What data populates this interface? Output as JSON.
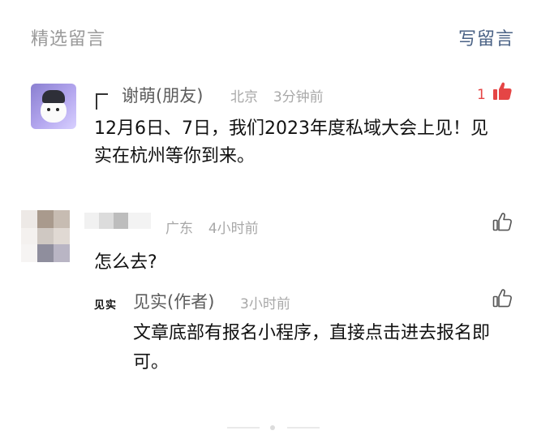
{
  "header": {
    "left_title": "精选留言",
    "right_action": "写留言"
  },
  "comments": [
    {
      "author": "谢萌(朋友)",
      "location": "北京",
      "time": "3分钟前",
      "likes": "1",
      "liked": true,
      "text": "12月6日、7日，我们2023年度私域大会上见！见实在杭州等你到来。",
      "icons": {
        "avatar": "avatar-bear-icon",
        "like": "thumbs-up-icon"
      },
      "colors": {
        "like_active": "#e54545"
      }
    },
    {
      "author": "",
      "location": "广东",
      "time": "4小时前",
      "text": "怎么去?",
      "icons": {
        "avatar": "avatar-pixelated",
        "like": "thumbs-up-icon"
      },
      "reply": {
        "logo_text": "见实",
        "author": "见实(作者)",
        "time": "3小时前",
        "text": "文章底部有报名小程序，直接点击进去报名即可。",
        "icons": {
          "like": "thumbs-up-icon"
        }
      }
    }
  ],
  "colors": {
    "header_muted": "#9a9a9a",
    "header_link": "#4a6285",
    "meta_text": "#a8a8a8",
    "name_text": "#5c5c5c"
  }
}
